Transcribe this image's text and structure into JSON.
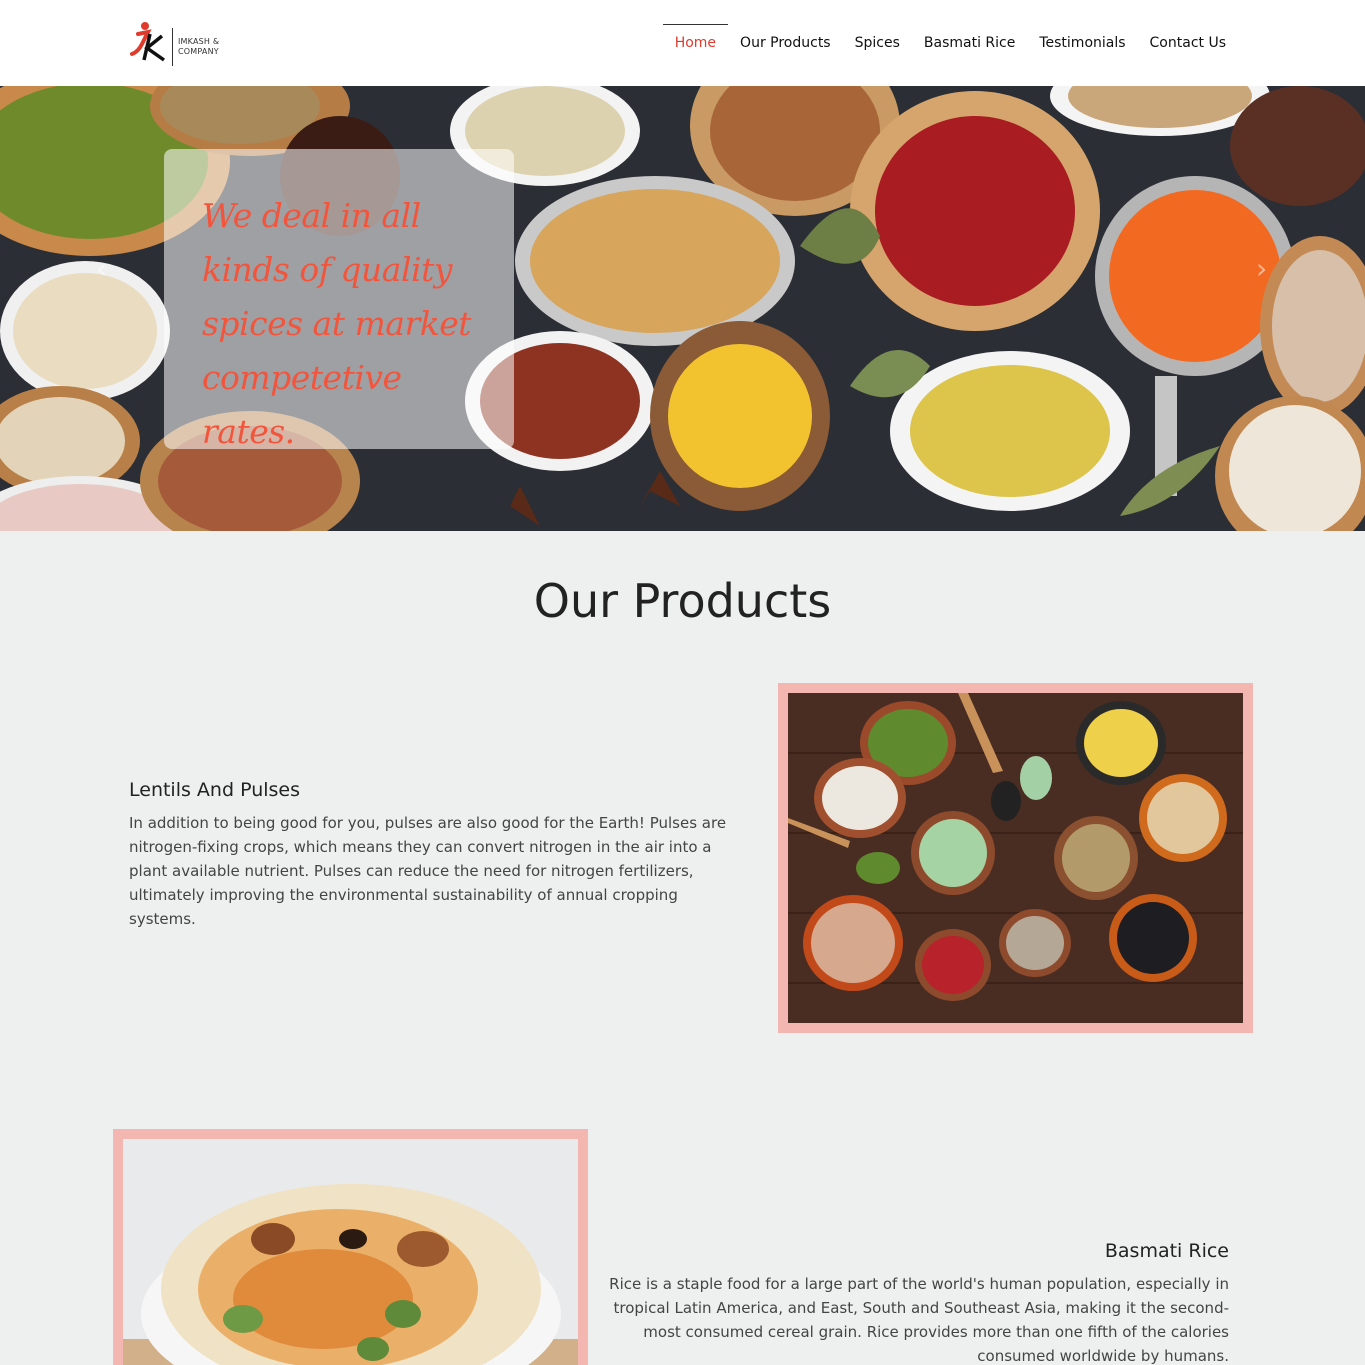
{
  "header": {
    "logo_text_line1": "IMKASH &",
    "logo_text_line2": "COMPANY",
    "nav": [
      {
        "label": "Home",
        "active": true
      },
      {
        "label": "Our Products",
        "active": false
      },
      {
        "label": "Spices",
        "active": false
      },
      {
        "label": "Basmati Rice",
        "active": false
      },
      {
        "label": "Testimonials",
        "active": false
      },
      {
        "label": "Contact Us",
        "active": false
      }
    ]
  },
  "hero": {
    "tagline_lines": [
      "We deal in all",
      "kinds of quality",
      "spices at market",
      "competetive rates."
    ],
    "prev_icon": "chevron-left-icon",
    "next_icon": "chevron-right-icon"
  },
  "products": {
    "title": "Our Products",
    "items": [
      {
        "heading": "Lentils And Pulses",
        "description": "In addition to being good for you, pulses are also good for the Earth! Pulses are nitrogen-fixing crops, which means they can convert nitrogen in the air into a plant available nutrient. Pulses can reduce the need for nitrogen fertilizers, ultimately improving the environmental sustainability of annual cropping systems."
      },
      {
        "heading": "Basmati Rice",
        "description": "Rice is a staple food for a large part of the world's human population, especially in tropical Latin America, and East, South and Southeast Asia, making it the second-most consumed cereal grain. Rice provides more than one fifth of the calories consumed worldwide by humans."
      }
    ]
  },
  "colors": {
    "accent": "#e03a2c",
    "hero_text": "#f2553b",
    "frame": "#f4b6b1",
    "background": "#eef0f0"
  }
}
